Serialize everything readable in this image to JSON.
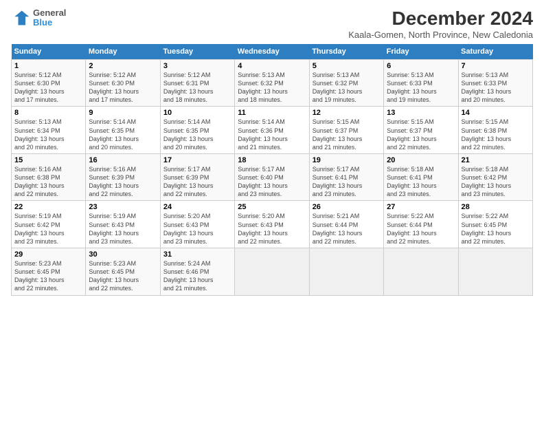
{
  "logo": {
    "line1": "General",
    "line2": "Blue"
  },
  "title": "December 2024",
  "subtitle": "Kaala-Gomen, North Province, New Caledonia",
  "days_of_week": [
    "Sunday",
    "Monday",
    "Tuesday",
    "Wednesday",
    "Thursday",
    "Friday",
    "Saturday"
  ],
  "weeks": [
    [
      {
        "day": "1",
        "info": "Sunrise: 5:12 AM\nSunset: 6:30 PM\nDaylight: 13 hours\nand 17 minutes."
      },
      {
        "day": "2",
        "info": "Sunrise: 5:12 AM\nSunset: 6:30 PM\nDaylight: 13 hours\nand 17 minutes."
      },
      {
        "day": "3",
        "info": "Sunrise: 5:12 AM\nSunset: 6:31 PM\nDaylight: 13 hours\nand 18 minutes."
      },
      {
        "day": "4",
        "info": "Sunrise: 5:13 AM\nSunset: 6:32 PM\nDaylight: 13 hours\nand 18 minutes."
      },
      {
        "day": "5",
        "info": "Sunrise: 5:13 AM\nSunset: 6:32 PM\nDaylight: 13 hours\nand 19 minutes."
      },
      {
        "day": "6",
        "info": "Sunrise: 5:13 AM\nSunset: 6:33 PM\nDaylight: 13 hours\nand 19 minutes."
      },
      {
        "day": "7",
        "info": "Sunrise: 5:13 AM\nSunset: 6:33 PM\nDaylight: 13 hours\nand 20 minutes."
      }
    ],
    [
      {
        "day": "8",
        "info": "Sunrise: 5:13 AM\nSunset: 6:34 PM\nDaylight: 13 hours\nand 20 minutes."
      },
      {
        "day": "9",
        "info": "Sunrise: 5:14 AM\nSunset: 6:35 PM\nDaylight: 13 hours\nand 20 minutes."
      },
      {
        "day": "10",
        "info": "Sunrise: 5:14 AM\nSunset: 6:35 PM\nDaylight: 13 hours\nand 20 minutes."
      },
      {
        "day": "11",
        "info": "Sunrise: 5:14 AM\nSunset: 6:36 PM\nDaylight: 13 hours\nand 21 minutes."
      },
      {
        "day": "12",
        "info": "Sunrise: 5:15 AM\nSunset: 6:37 PM\nDaylight: 13 hours\nand 21 minutes."
      },
      {
        "day": "13",
        "info": "Sunrise: 5:15 AM\nSunset: 6:37 PM\nDaylight: 13 hours\nand 22 minutes."
      },
      {
        "day": "14",
        "info": "Sunrise: 5:15 AM\nSunset: 6:38 PM\nDaylight: 13 hours\nand 22 minutes."
      }
    ],
    [
      {
        "day": "15",
        "info": "Sunrise: 5:16 AM\nSunset: 6:38 PM\nDaylight: 13 hours\nand 22 minutes."
      },
      {
        "day": "16",
        "info": "Sunrise: 5:16 AM\nSunset: 6:39 PM\nDaylight: 13 hours\nand 22 minutes."
      },
      {
        "day": "17",
        "info": "Sunrise: 5:17 AM\nSunset: 6:39 PM\nDaylight: 13 hours\nand 22 minutes."
      },
      {
        "day": "18",
        "info": "Sunrise: 5:17 AM\nSunset: 6:40 PM\nDaylight: 13 hours\nand 23 minutes."
      },
      {
        "day": "19",
        "info": "Sunrise: 5:17 AM\nSunset: 6:41 PM\nDaylight: 13 hours\nand 23 minutes."
      },
      {
        "day": "20",
        "info": "Sunrise: 5:18 AM\nSunset: 6:41 PM\nDaylight: 13 hours\nand 23 minutes."
      },
      {
        "day": "21",
        "info": "Sunrise: 5:18 AM\nSunset: 6:42 PM\nDaylight: 13 hours\nand 23 minutes."
      }
    ],
    [
      {
        "day": "22",
        "info": "Sunrise: 5:19 AM\nSunset: 6:42 PM\nDaylight: 13 hours\nand 23 minutes."
      },
      {
        "day": "23",
        "info": "Sunrise: 5:19 AM\nSunset: 6:43 PM\nDaylight: 13 hours\nand 23 minutes."
      },
      {
        "day": "24",
        "info": "Sunrise: 5:20 AM\nSunset: 6:43 PM\nDaylight: 13 hours\nand 23 minutes."
      },
      {
        "day": "25",
        "info": "Sunrise: 5:20 AM\nSunset: 6:43 PM\nDaylight: 13 hours\nand 22 minutes."
      },
      {
        "day": "26",
        "info": "Sunrise: 5:21 AM\nSunset: 6:44 PM\nDaylight: 13 hours\nand 22 minutes."
      },
      {
        "day": "27",
        "info": "Sunrise: 5:22 AM\nSunset: 6:44 PM\nDaylight: 13 hours\nand 22 minutes."
      },
      {
        "day": "28",
        "info": "Sunrise: 5:22 AM\nSunset: 6:45 PM\nDaylight: 13 hours\nand 22 minutes."
      }
    ],
    [
      {
        "day": "29",
        "info": "Sunrise: 5:23 AM\nSunset: 6:45 PM\nDaylight: 13 hours\nand 22 minutes."
      },
      {
        "day": "30",
        "info": "Sunrise: 5:23 AM\nSunset: 6:45 PM\nDaylight: 13 hours\nand 22 minutes."
      },
      {
        "day": "31",
        "info": "Sunrise: 5:24 AM\nSunset: 6:46 PM\nDaylight: 13 hours\nand 21 minutes."
      },
      null,
      null,
      null,
      null
    ]
  ]
}
